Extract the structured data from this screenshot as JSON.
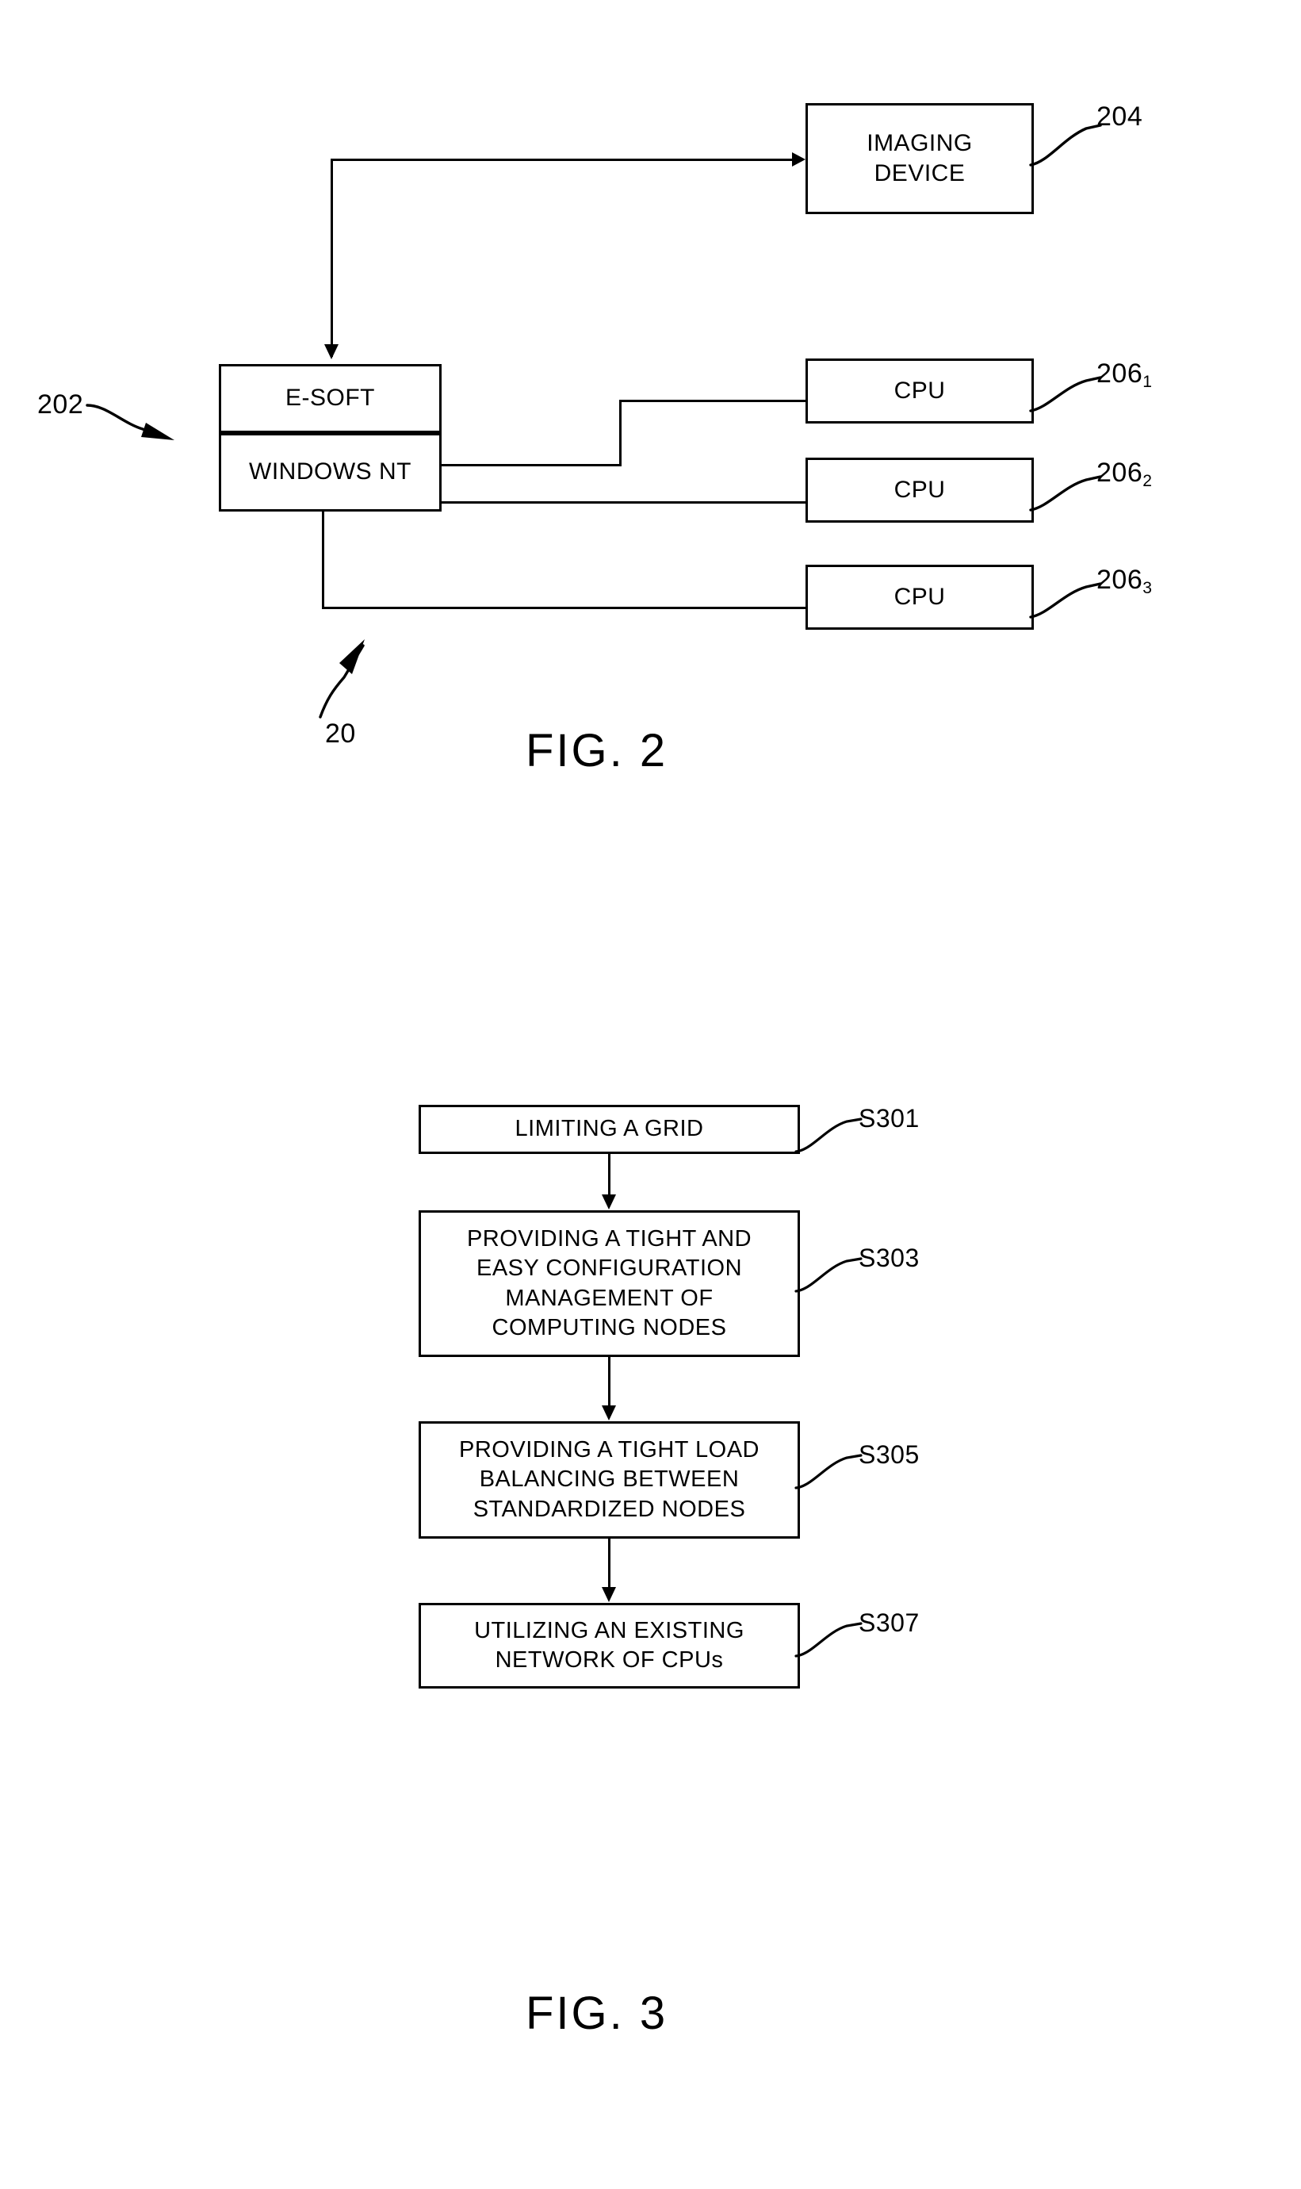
{
  "figures": [
    {
      "id": "fig2",
      "caption": "FIG. 2",
      "system_ref": "20",
      "blocks": {
        "imaging_device": {
          "label": "IMAGING\nDEVICE",
          "ref": "204"
        },
        "server": {
          "top_label": "E-SOFT",
          "bottom_label": "WINDOWS NT",
          "ref": "202"
        },
        "cpus": [
          {
            "label": "CPU",
            "ref_base": "206",
            "ref_sub": "1"
          },
          {
            "label": "CPU",
            "ref_base": "206",
            "ref_sub": "2"
          },
          {
            "label": "CPU",
            "ref_base": "206",
            "ref_sub": "3"
          }
        ]
      }
    },
    {
      "id": "fig3",
      "caption": "FIG. 3",
      "steps": [
        {
          "text": "LIMITING A GRID",
          "ref": "S301"
        },
        {
          "text": "PROVIDING A TIGHT AND\nEASY CONFIGURATION\nMANAGEMENT OF\nCOMPUTING NODES",
          "ref": "S303"
        },
        {
          "text": "PROVIDING A TIGHT LOAD\nBALANCING BETWEEN\nSTANDARDIZED NODES",
          "ref": "S305"
        },
        {
          "text": "UTILIZING AN EXISTING\nNETWORK OF CPUs",
          "ref": "S307"
        }
      ]
    }
  ],
  "colors": {
    "ink": "#000000",
    "paper": "#ffffff"
  }
}
